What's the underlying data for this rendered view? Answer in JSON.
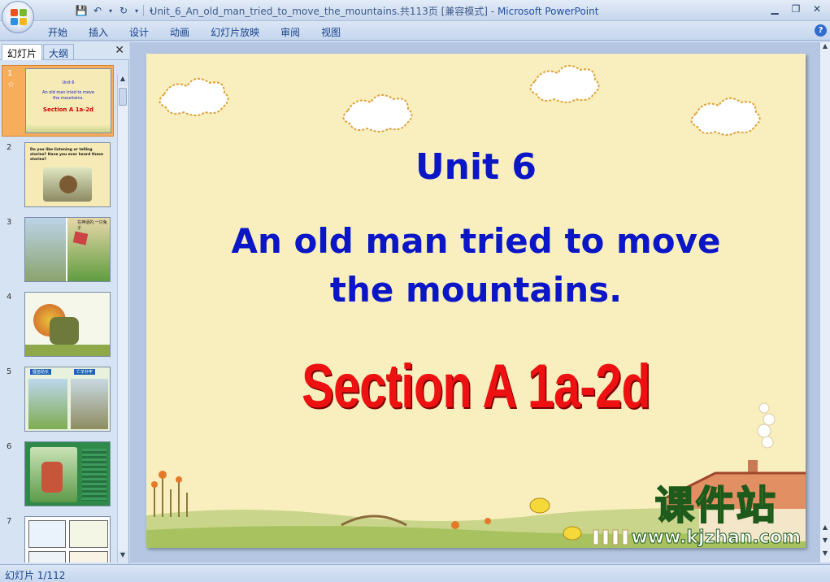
{
  "window": {
    "title": "Unit_6_An_old_man_tried_to_move_the_mountains.共113页 [兼容模式]",
    "app_name": "Microsoft PowerPoint",
    "controls": {
      "minimize": "▁",
      "maximize": "❐",
      "close": "✕"
    }
  },
  "ribbon": {
    "tabs": [
      "开始",
      "插入",
      "设计",
      "动画",
      "幻灯片放映",
      "审阅",
      "视图"
    ],
    "help": "?"
  },
  "quick_access": {
    "save": "💾",
    "undo": "↶",
    "redo": "↻",
    "more": "▾"
  },
  "pane": {
    "tabs": [
      "幻灯片",
      "大纲"
    ],
    "close": "✕",
    "thumbnails": [
      {
        "number": "1",
        "star": "☆",
        "selected": true,
        "lines": [
          "Unit 6",
          "An old man tried to move",
          "the mountains.",
          "Section A 1a-2d"
        ]
      },
      {
        "number": "2",
        "lines": [
          "Do you like listening or telling",
          "stories? Have you ever heard these",
          "stories?"
        ]
      },
      {
        "number": "3",
        "lines": [
          "在神话的,一只兔子"
        ]
      },
      {
        "number": "4",
        "lines": []
      },
      {
        "number": "5",
        "lines": [
          "揠苗助长",
          "亡羊补牢"
        ]
      },
      {
        "number": "6",
        "lines": []
      },
      {
        "number": "7",
        "lines": []
      }
    ]
  },
  "slide": {
    "unit": "Unit 6",
    "title_line1": "An old man tried to move",
    "title_line2": "the mountains.",
    "section": "Section A 1a-2d"
  },
  "watermark": {
    "chinese": "课件站",
    "url": "www.kjzhan.com"
  },
  "status": {
    "slide_counter": "幻灯片 1/112"
  },
  "colors": {
    "title_blue": "#0b16c6",
    "section_red": "#ee1111",
    "slide_bg": "#f9efbe"
  }
}
